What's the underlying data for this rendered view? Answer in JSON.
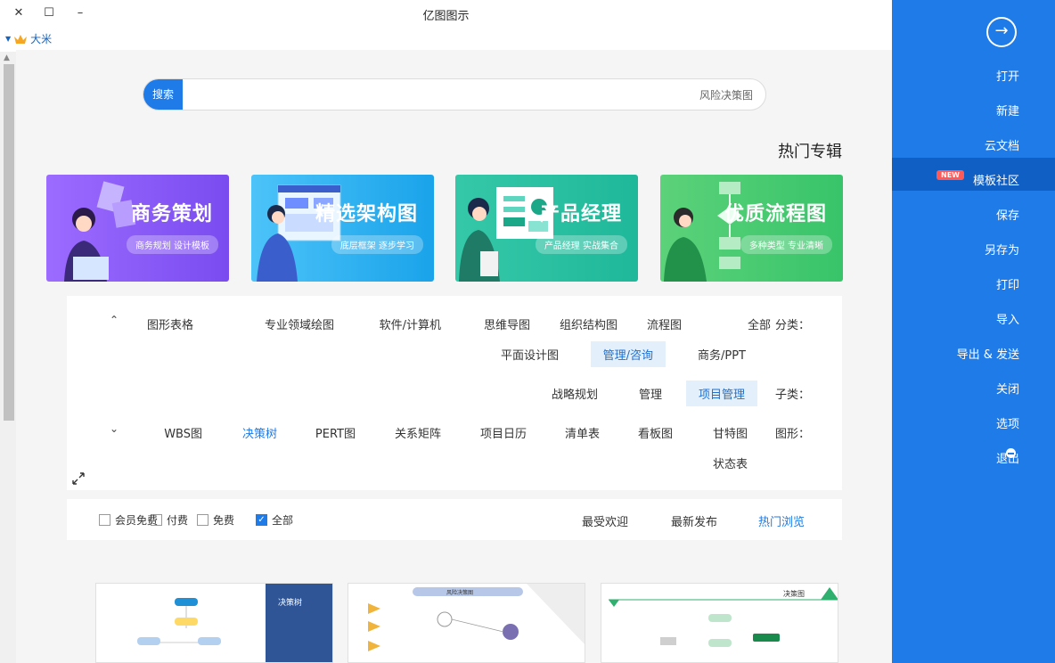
{
  "window": {
    "title": "亿图图示",
    "close": "✕",
    "maximize": "☐",
    "minimize": "–"
  },
  "user": {
    "name": "大米"
  },
  "search": {
    "button": "搜索",
    "placeholder": "风险决策图"
  },
  "section_title": "热门专辑",
  "banners": [
    {
      "title": "商务策划",
      "subtitle": "商务规划 设计模板",
      "color_from": "#7c4dff",
      "color_to": "#b388ff"
    },
    {
      "title": "精选架构图",
      "subtitle": "底层框架 逐步学习",
      "color_from": "#29b6f6",
      "color_to": "#4fc3f7"
    },
    {
      "title": "产品经理",
      "subtitle": "产品经理 实战集合",
      "color_from": "#26c6a0",
      "color_to": "#4dd0b8"
    },
    {
      "title": "优质流程图",
      "subtitle": "多种类型 专业清晰",
      "color_from": "#4caf50",
      "color_to": "#81c784"
    }
  ],
  "filter": {
    "category_label": "分类：",
    "categories_row1": [
      "全部",
      "流程图",
      "组织结构图",
      "思维导图",
      "软件/计算机",
      "专业领域绘图",
      "图形表格"
    ],
    "categories_row2": [
      "商务/PPT",
      "管理/咨询",
      "平面设计图"
    ],
    "category_selected": "管理/咨询",
    "sub_label": "子类：",
    "subcategories": [
      "项目管理",
      "管理",
      "战略规划"
    ],
    "sub_selected": "项目管理",
    "shape_label": "图形：",
    "shapes_row1": [
      "甘特图",
      "看板图",
      "清单表",
      "项目日历",
      "关系矩阵",
      "PERT图",
      "决策树",
      "WBS图"
    ],
    "shapes_row2": [
      "状态表"
    ],
    "shape_highlight": "决策树"
  },
  "sort": {
    "tabs": [
      "热门浏览",
      "最新发布",
      "最受欢迎"
    ],
    "active": "热门浏览",
    "checks": [
      {
        "label": "全部",
        "checked": true
      },
      {
        "label": "免费",
        "checked": false
      },
      {
        "label": "付费",
        "checked": false
      },
      {
        "label": "会员免费",
        "checked": false
      }
    ]
  },
  "thumbnails": [
    {
      "title": "决策树"
    },
    {
      "title": "风险决策图"
    },
    {
      "title": "决策图"
    }
  ],
  "sidebar": {
    "items": [
      "打开",
      "新建",
      "云文档",
      "模板社区",
      "保存",
      "另存为",
      "打印",
      "导入",
      "导出 & 发送",
      "关闭",
      "选项",
      "退出"
    ],
    "active": "模板社区",
    "new_badge": "NEW"
  }
}
